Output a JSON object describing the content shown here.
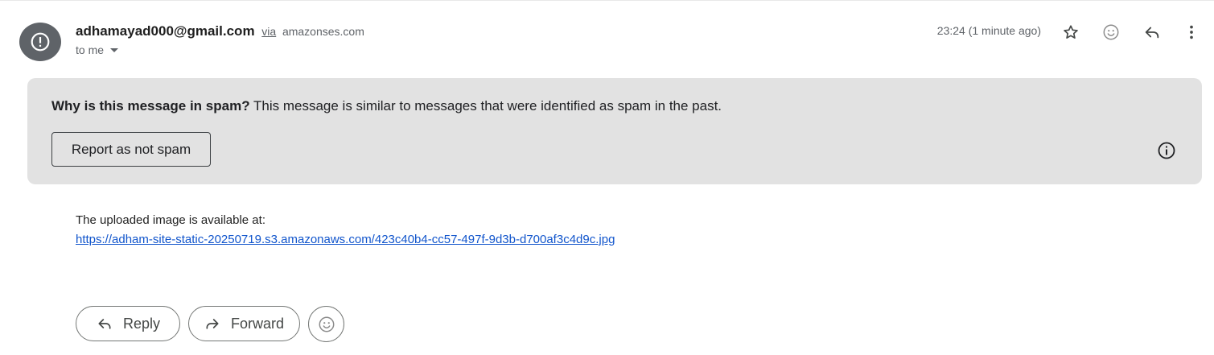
{
  "message": {
    "sender_email": "adhamayad000@gmail.com",
    "via_label": "via",
    "via_domain": "amazonses.com",
    "recipient_label": "to me",
    "timestamp": "23:24 (1 minute ago)"
  },
  "header_actions": {
    "star_icon": "star-icon",
    "emoji_icon": "emoji-icon",
    "reply_icon": "reply-icon",
    "more_icon": "more-vert-icon"
  },
  "spam_banner": {
    "heading": "Why is this message in spam?",
    "explanation": "This message is similar to messages that were identified as spam in the past.",
    "report_button_label": "Report as not spam",
    "info_icon": "info-icon"
  },
  "body": {
    "line1": "The uploaded image is available at:",
    "link_text": "https://adham-site-static-20250719.s3.amazonaws.com/423c40b4-cc57-497f-9d3b-d700af3c4d9c.jpg"
  },
  "actions": {
    "reply_label": "Reply",
    "forward_label": "Forward"
  },
  "colors": {
    "banner_bg": "#e2e2e2",
    "avatar_bg": "#5f6368",
    "link": "#1155cc"
  }
}
